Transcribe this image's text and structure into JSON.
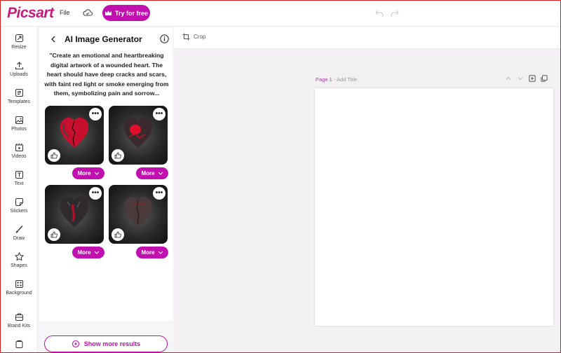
{
  "app": {
    "logo": "Picsart",
    "file_menu": "File",
    "try_button": "Try for free"
  },
  "rail": [
    {
      "label": "Resize",
      "icon": "resize-icon"
    },
    {
      "label": "Uploads",
      "icon": "upload-icon"
    },
    {
      "label": "Templates",
      "icon": "templates-icon"
    },
    {
      "label": "Photos",
      "icon": "photos-icon"
    },
    {
      "label": "Videos",
      "icon": "videos-icon"
    },
    {
      "label": "Text",
      "icon": "text-icon"
    },
    {
      "label": "Stickers",
      "icon": "stickers-icon"
    },
    {
      "label": "Draw",
      "icon": "draw-icon"
    },
    {
      "label": "Shapes",
      "icon": "shapes-icon"
    },
    {
      "label": "Background",
      "icon": "background-icon"
    },
    {
      "label": "Brand Kits",
      "icon": "brand-kits-icon"
    }
  ],
  "panel": {
    "title": "AI Image Generator",
    "prompt": "\"Create an emotional and heartbreaking digital artwork of a wounded heart. The heart should have deep cracks and scars, with faint red light or smoke emerging from them, symbolizing pain and sorrow...",
    "results": [
      {
        "more_label": "More",
        "accent": "#c8102e"
      },
      {
        "more_label": "More",
        "accent": "#e0102a"
      },
      {
        "more_label": "More",
        "accent": "#b8102a"
      },
      {
        "more_label": "More",
        "accent": "#7a2a2a"
      }
    ],
    "show_more": "Show more results"
  },
  "toolbar": {
    "crop_label": "Crop"
  },
  "canvas": {
    "page_label": "Page 1",
    "separator": " - ",
    "title_placeholder": "Add Title"
  },
  "colors": {
    "brand": "#c20fb0",
    "logo": "#c8197f",
    "workspace": "#f2f0f3"
  }
}
